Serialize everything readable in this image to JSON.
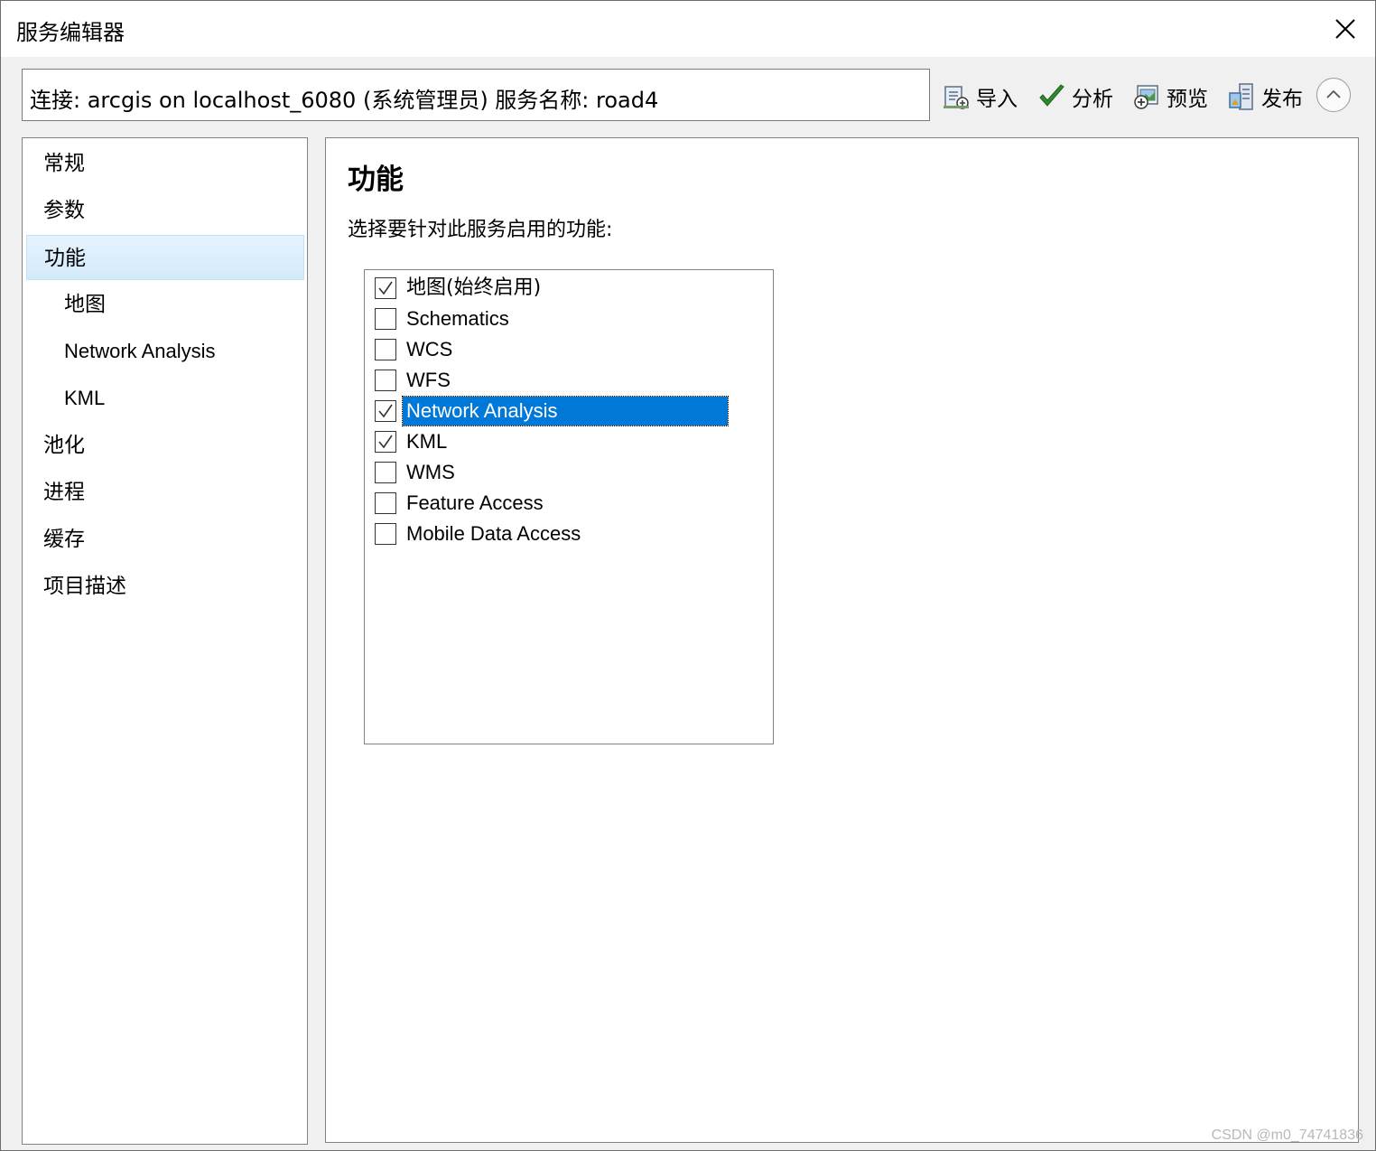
{
  "window": {
    "title": "服务编辑器"
  },
  "connection": {
    "text": "连接: arcgis on localhost_6080 (系统管理员)   服务名称: road4"
  },
  "toolbar": {
    "import_label": "导入",
    "analyze_label": "分析",
    "preview_label": "预览",
    "publish_label": "发布"
  },
  "sidebar": {
    "items": [
      {
        "label": "常规",
        "level": 0,
        "selected": false
      },
      {
        "label": "参数",
        "level": 0,
        "selected": false
      },
      {
        "label": "功能",
        "level": 0,
        "selected": true
      },
      {
        "label": "地图",
        "level": 1,
        "selected": false
      },
      {
        "label": "Network Analysis",
        "level": 1,
        "selected": false
      },
      {
        "label": "KML",
        "level": 1,
        "selected": false
      },
      {
        "label": "池化",
        "level": 0,
        "selected": false
      },
      {
        "label": "进程",
        "level": 0,
        "selected": false
      },
      {
        "label": "缓存",
        "level": 0,
        "selected": false
      },
      {
        "label": "项目描述",
        "level": 0,
        "selected": false
      }
    ]
  },
  "content": {
    "title": "功能",
    "description": "选择要针对此服务启用的功能:",
    "capabilities": [
      {
        "label": "地图(始终启用)",
        "checked": true,
        "selected": false
      },
      {
        "label": "Schematics",
        "checked": false,
        "selected": false
      },
      {
        "label": "WCS",
        "checked": false,
        "selected": false
      },
      {
        "label": "WFS",
        "checked": false,
        "selected": false
      },
      {
        "label": "Network Analysis",
        "checked": true,
        "selected": true
      },
      {
        "label": "KML",
        "checked": true,
        "selected": false
      },
      {
        "label": "WMS",
        "checked": false,
        "selected": false
      },
      {
        "label": "Feature Access",
        "checked": false,
        "selected": false
      },
      {
        "label": "Mobile Data Access",
        "checked": false,
        "selected": false
      }
    ]
  },
  "watermark": "CSDN @m0_74741836",
  "colors": {
    "selection": "#0078d7",
    "nav_selected": "#d3eafb",
    "check_green": "#2e8b2e"
  }
}
